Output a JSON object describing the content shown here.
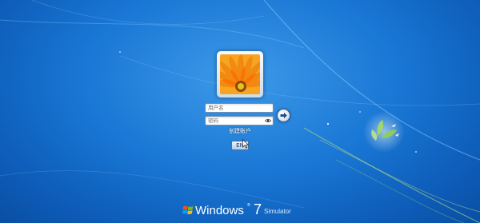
{
  "login": {
    "username_placeholder": "用户名",
    "password_placeholder": "密码",
    "create_account_label": "创建账户",
    "language_label": "EN"
  },
  "branding": {
    "wordmark": "Windows",
    "trademark": "®",
    "version": "7",
    "edition": "Simulator"
  },
  "colors": {
    "background": "#1a78d6",
    "avatar_flower": "#f28a12",
    "leaf_green": "#8fd14f"
  },
  "icons": {
    "go": "arrow-right-icon",
    "password_reveal": "eye-icon",
    "logo": "windows-flag-icon"
  }
}
